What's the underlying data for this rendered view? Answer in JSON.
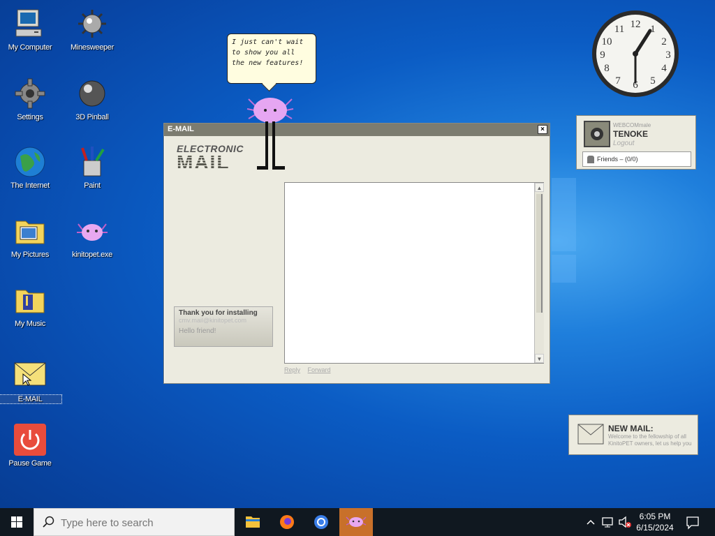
{
  "desktop": {
    "icons": [
      {
        "label": "My Computer"
      },
      {
        "label": "Minesweeper"
      },
      {
        "label": "Settings"
      },
      {
        "label": "3D Pinball"
      },
      {
        "label": "The Internet"
      },
      {
        "label": "Paint"
      },
      {
        "label": "My Pictures"
      },
      {
        "label": "kinitopet.exe"
      },
      {
        "label": "My Music"
      },
      {
        "label": "E-MAIL"
      },
      {
        "label": "Pause Game"
      }
    ]
  },
  "pet": {
    "speech": "I just can't wait to show you all the new features!"
  },
  "email_window": {
    "title": "E-MAIL",
    "close_label": "×",
    "logo_line1": "ELECTRONIC",
    "logo_line2": "MAIL",
    "message": {
      "subject": "Thank you for installing",
      "from": "cmv.mail@kinitopet.com",
      "preview": "Hello friend!"
    },
    "actions": {
      "reply": "Reply",
      "forward": "Forward"
    }
  },
  "profile_widget": {
    "small_text": "WEBCOMmale",
    "name": "TENOKE",
    "logout": "Logout",
    "friends": "Friends – (0/0)"
  },
  "new_mail_widget": {
    "title": "NEW MAIL:",
    "text": "Welcome to the fellowship of all KinitoPET owners, let us help you"
  },
  "taskbar": {
    "search_placeholder": "Type here to search",
    "time": "6:05 PM",
    "date": "6/15/2024"
  },
  "colors": {
    "desktop_bg": "#0b5cc4",
    "taskbar_bg": "#101820",
    "active_app": "#c8702a",
    "window_bg": "#ecebe0",
    "window_title": "#7c7c70"
  }
}
